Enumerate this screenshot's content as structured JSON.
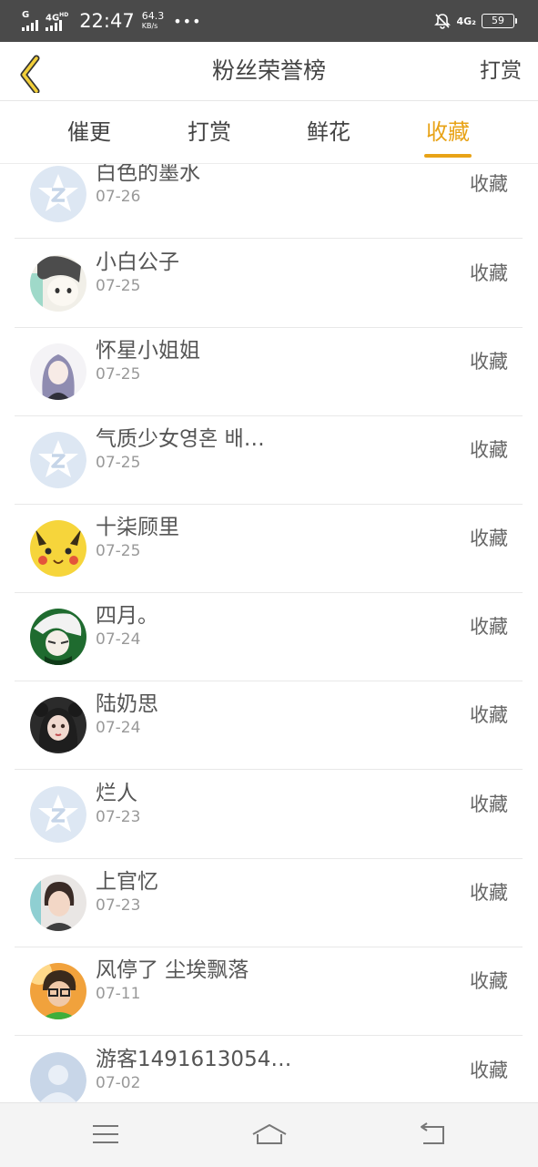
{
  "status_bar": {
    "sim1": "G",
    "sim2": "4G",
    "sim2_sup": "HD",
    "time": "22:47",
    "speed_value": "64.3",
    "speed_unit": "KB/s",
    "dots": "•••",
    "network": "4G₂",
    "battery": "59"
  },
  "header": {
    "title": "粉丝荣誉榜",
    "action_label": "打赏"
  },
  "tabs": [
    {
      "label": "催更",
      "active": false
    },
    {
      "label": "打赏",
      "active": false
    },
    {
      "label": "鲜花",
      "active": false
    },
    {
      "label": "收藏",
      "active": true
    }
  ],
  "colors": {
    "accent": "#e8a317"
  },
  "list": [
    {
      "name": "白色的墨水",
      "date": "07-26",
      "action": "收藏",
      "avatar": "qq-default-avatar"
    },
    {
      "name": "小白公子",
      "date": "07-25",
      "action": "收藏",
      "avatar": "anime-boy-avatar"
    },
    {
      "name": "怀星小姐姐",
      "date": "07-25",
      "action": "收藏",
      "avatar": "anime-girl-avatar"
    },
    {
      "name": "气质少女영혼 배…",
      "date": "07-25",
      "action": "收藏",
      "avatar": "qq-default-avatar"
    },
    {
      "name": "十柒顾里",
      "date": "07-25",
      "action": "收藏",
      "avatar": "pikachu-avatar"
    },
    {
      "name": "四月。",
      "date": "07-24",
      "action": "收藏",
      "avatar": "green-anime-avatar"
    },
    {
      "name": "陆奶思",
      "date": "07-24",
      "action": "收藏",
      "avatar": "dark-girl-avatar"
    },
    {
      "name": "烂人",
      "date": "07-23",
      "action": "收藏",
      "avatar": "qq-default-avatar"
    },
    {
      "name": "上官忆",
      "date": "07-23",
      "action": "收藏",
      "avatar": "child-photo-avatar"
    },
    {
      "name": "风停了 尘埃飘落",
      "date": "07-11",
      "action": "收藏",
      "avatar": "glasses-boy-avatar"
    },
    {
      "name": "游客1491613054…",
      "date": "07-02",
      "action": "收藏",
      "avatar": "guest-default-avatar"
    }
  ],
  "nav": [
    "menu-icon",
    "home-icon",
    "back-icon"
  ]
}
